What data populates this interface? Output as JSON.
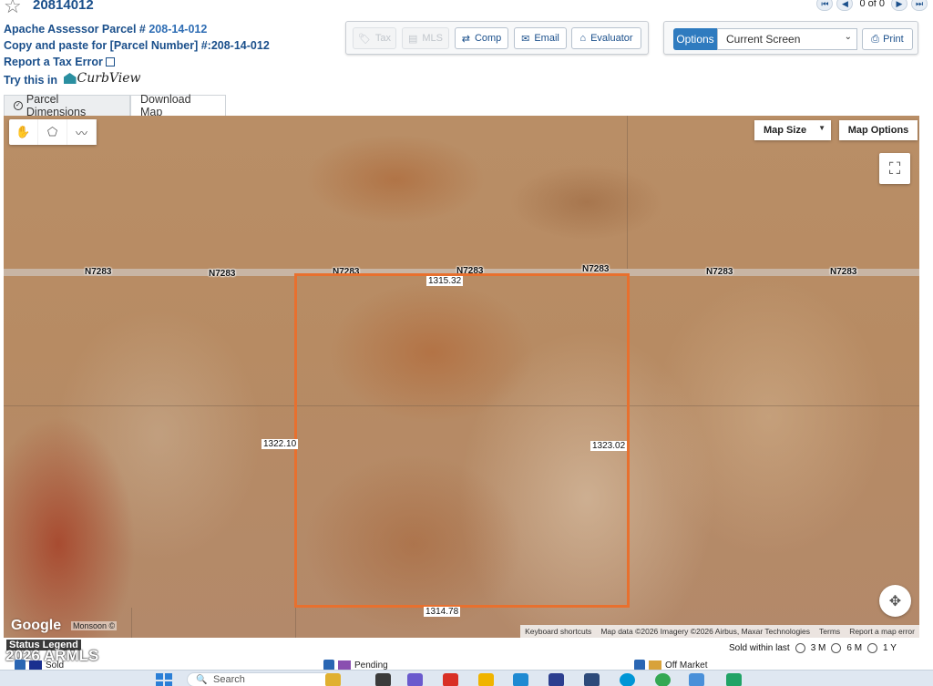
{
  "header": {
    "mls_number": "20814012",
    "parcel_line_prefix": "Apache Assessor Parcel # ",
    "parcel_number": "208-14-012",
    "copy_line": "Copy and paste for [Parcel Number] #:208-14-012",
    "tax_error_link": "Report a Tax Error",
    "try_prefix": "Try this in",
    "curbview": "CurbView",
    "pager_text": "0 of 0"
  },
  "toolbar": {
    "tax": "Tax",
    "mls": "MLS",
    "comp": "Comp",
    "email": "Email",
    "evaluator": "Evaluator",
    "options": "Options",
    "current_screen": "Current Screen",
    "print": "Print"
  },
  "tabs": {
    "parcel_dimensions": "Parcel Dimensions",
    "download_map": "Download Map"
  },
  "map": {
    "road_name": "N7283",
    "dim_top": "1315.32",
    "dim_left": "1322.10",
    "dim_right": "1323.02",
    "dim_bottom": "1314.78",
    "map_size": "Map Size",
    "map_options": "Map Options",
    "google": "Google",
    "monsoon": "Monsoon ©",
    "keyboard_shortcuts": "Keyboard shortcuts",
    "map_data": "Map data ©2026 Imagery ©2026 Airbus, Maxar Technologies",
    "terms": "Terms",
    "report_error": "Report a map error"
  },
  "legend": {
    "title": "Status Legend",
    "copyright": "2026 ARMLS",
    "sold_within": "Sold within last",
    "opt_3m": "3 M",
    "opt_6m": "6 M",
    "opt_1y": "1 Y",
    "active": "Sold",
    "pending": "Pending",
    "off_market": "Off Market"
  },
  "taskbar": {
    "search": "Search"
  },
  "colors": {
    "accent": "#2f7bbf",
    "parcel_outline": "#e8702e",
    "link": "#1a4f8b"
  }
}
